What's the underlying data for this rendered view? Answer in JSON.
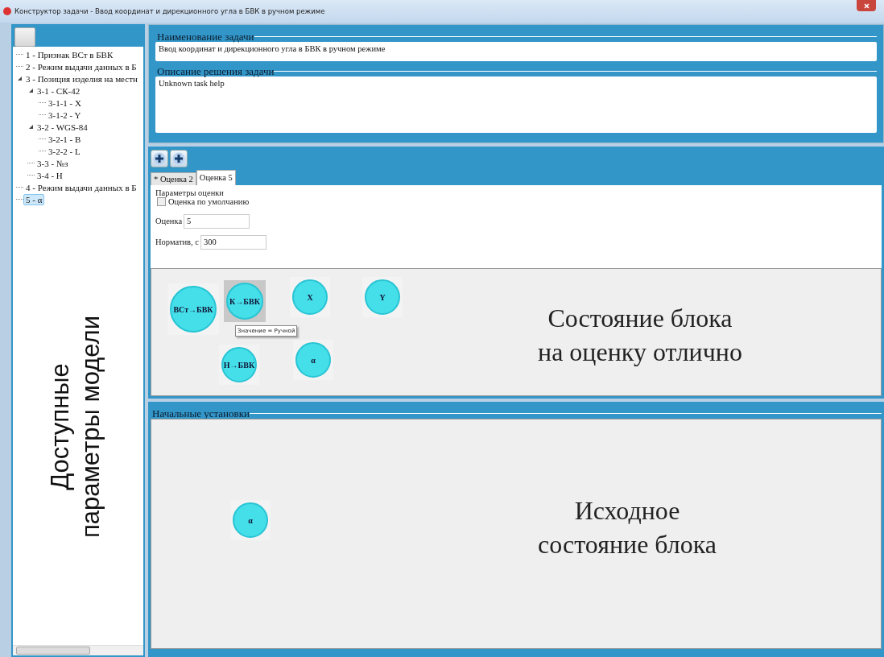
{
  "window": {
    "title": "Конструктор задачи - Ввод координат и дирекционного угла в БВК в ручном режиме"
  },
  "sidebar": {
    "caption": "Доступные параметры модели",
    "tree": [
      {
        "label": "1 - Признак ВСт в БВК",
        "selected": false
      },
      {
        "label": "2 - Режим выдачи данных в Б",
        "selected": false
      },
      {
        "label": "3 - Позиция изделия на местн",
        "expanded": true,
        "selected": false,
        "children": [
          {
            "label": "3-1 - СК-42",
            "expanded": true,
            "selected": false,
            "children": [
              {
                "label": "3-1-1 - X",
                "selected": false
              },
              {
                "label": "3-1-2 - Y",
                "selected": false
              }
            ]
          },
          {
            "label": "3-2 - WGS-84",
            "expanded": true,
            "selected": false,
            "children": [
              {
                "label": "3-2-1 - B",
                "selected": false
              },
              {
                "label": "3-2-2 - L",
                "selected": false
              }
            ]
          },
          {
            "label": "3-3 - №з",
            "selected": false
          },
          {
            "label": "3-4 - H",
            "selected": false
          }
        ]
      },
      {
        "label": "4 - Режим выдачи данных в Б",
        "selected": false
      },
      {
        "label": "5 - α",
        "selected": true
      }
    ]
  },
  "task": {
    "name_legend": "Наименование задачи",
    "name": "Ввод координат и дирекционного угла в БВК в ручном режиме",
    "help_legend": "Описание решения задачи",
    "help": "Unknown task help"
  },
  "grades": {
    "tabs": [
      {
        "label": "* Оценка 2",
        "selected": false
      },
      {
        "label": "Оценка 5",
        "selected": true
      }
    ],
    "params_legend": "Параметры оценки",
    "default_checkbox": {
      "label": "Оценка по умолчанию",
      "checked": false
    },
    "fields": [
      {
        "label": "Оценка",
        "value": "5"
      },
      {
        "label": "Норматив, с",
        "value": "300"
      }
    ],
    "nodes": [
      {
        "label": "ВСт→БВК",
        "selected": false
      },
      {
        "label": "К→БВК",
        "selected": true
      },
      {
        "label": "X",
        "selected": false
      },
      {
        "label": "Y",
        "selected": false
      },
      {
        "label": "Н→БВК",
        "selected": false
      },
      {
        "label": "α",
        "selected": false
      }
    ],
    "tooltip": "Значение = Ручной",
    "canvas_caption": [
      "Состояние блока",
      "на оценку отлично"
    ]
  },
  "initial": {
    "legend": "Начальные установки",
    "nodes": [
      {
        "label": "α",
        "selected": false
      }
    ],
    "canvas_caption": [
      "Исходное",
      "состояние блока"
    ]
  }
}
